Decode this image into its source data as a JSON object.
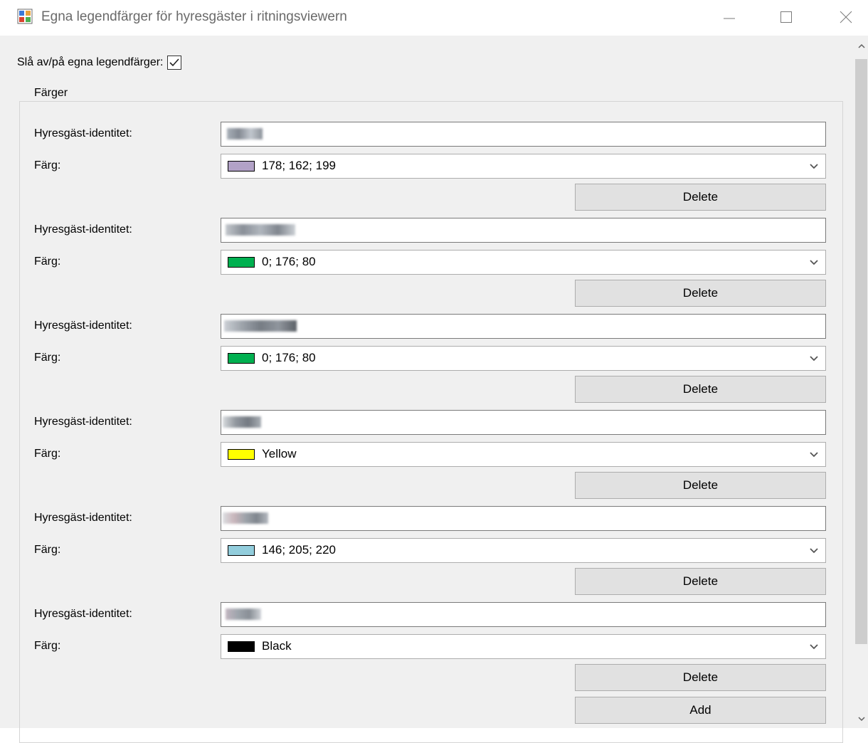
{
  "window": {
    "title": "Egna legendfärger för hyresgäster i ritningsviewern",
    "controls": [
      "minimize",
      "maximize",
      "close"
    ]
  },
  "toggle": {
    "label": "Slå av/på egna legendfärger:",
    "checked": true
  },
  "group": {
    "label": "Färger"
  },
  "tenants": [
    {
      "id_label": "Hyresgäst-identitet:",
      "color_label": "Färg:",
      "color_text": "178; 162; 199",
      "color_hex": "#b2a2c7",
      "delete_label": "Delete"
    },
    {
      "id_label": "Hyresgäst-identitet:",
      "color_label": "Färg:",
      "color_text": "0; 176; 80",
      "color_hex": "#00b050",
      "delete_label": "Delete"
    },
    {
      "id_label": "Hyresgäst-identitet:",
      "color_label": "Färg:",
      "color_text": "0; 176; 80",
      "color_hex": "#00b050",
      "delete_label": "Delete"
    },
    {
      "id_label": "Hyresgäst-identitet:",
      "color_label": "Färg:",
      "color_text": "Yellow",
      "color_hex": "#ffff00",
      "delete_label": "Delete"
    },
    {
      "id_label": "Hyresgäst-identitet:",
      "color_label": "Färg:",
      "color_text": "146; 205; 220",
      "color_hex": "#92cddc",
      "delete_label": "Delete"
    },
    {
      "id_label": "Hyresgäst-identitet:",
      "color_label": "Färg:",
      "color_text": "Black",
      "color_hex": "#000000",
      "delete_label": "Delete"
    }
  ],
  "add_label": "Add",
  "icons": {
    "dropdown": "chevron-down-icon",
    "checkbox": "checkmark-icon",
    "scroll_up": "scroll-up-arrow-icon",
    "scroll_down": "scroll-down-arrow-icon"
  }
}
